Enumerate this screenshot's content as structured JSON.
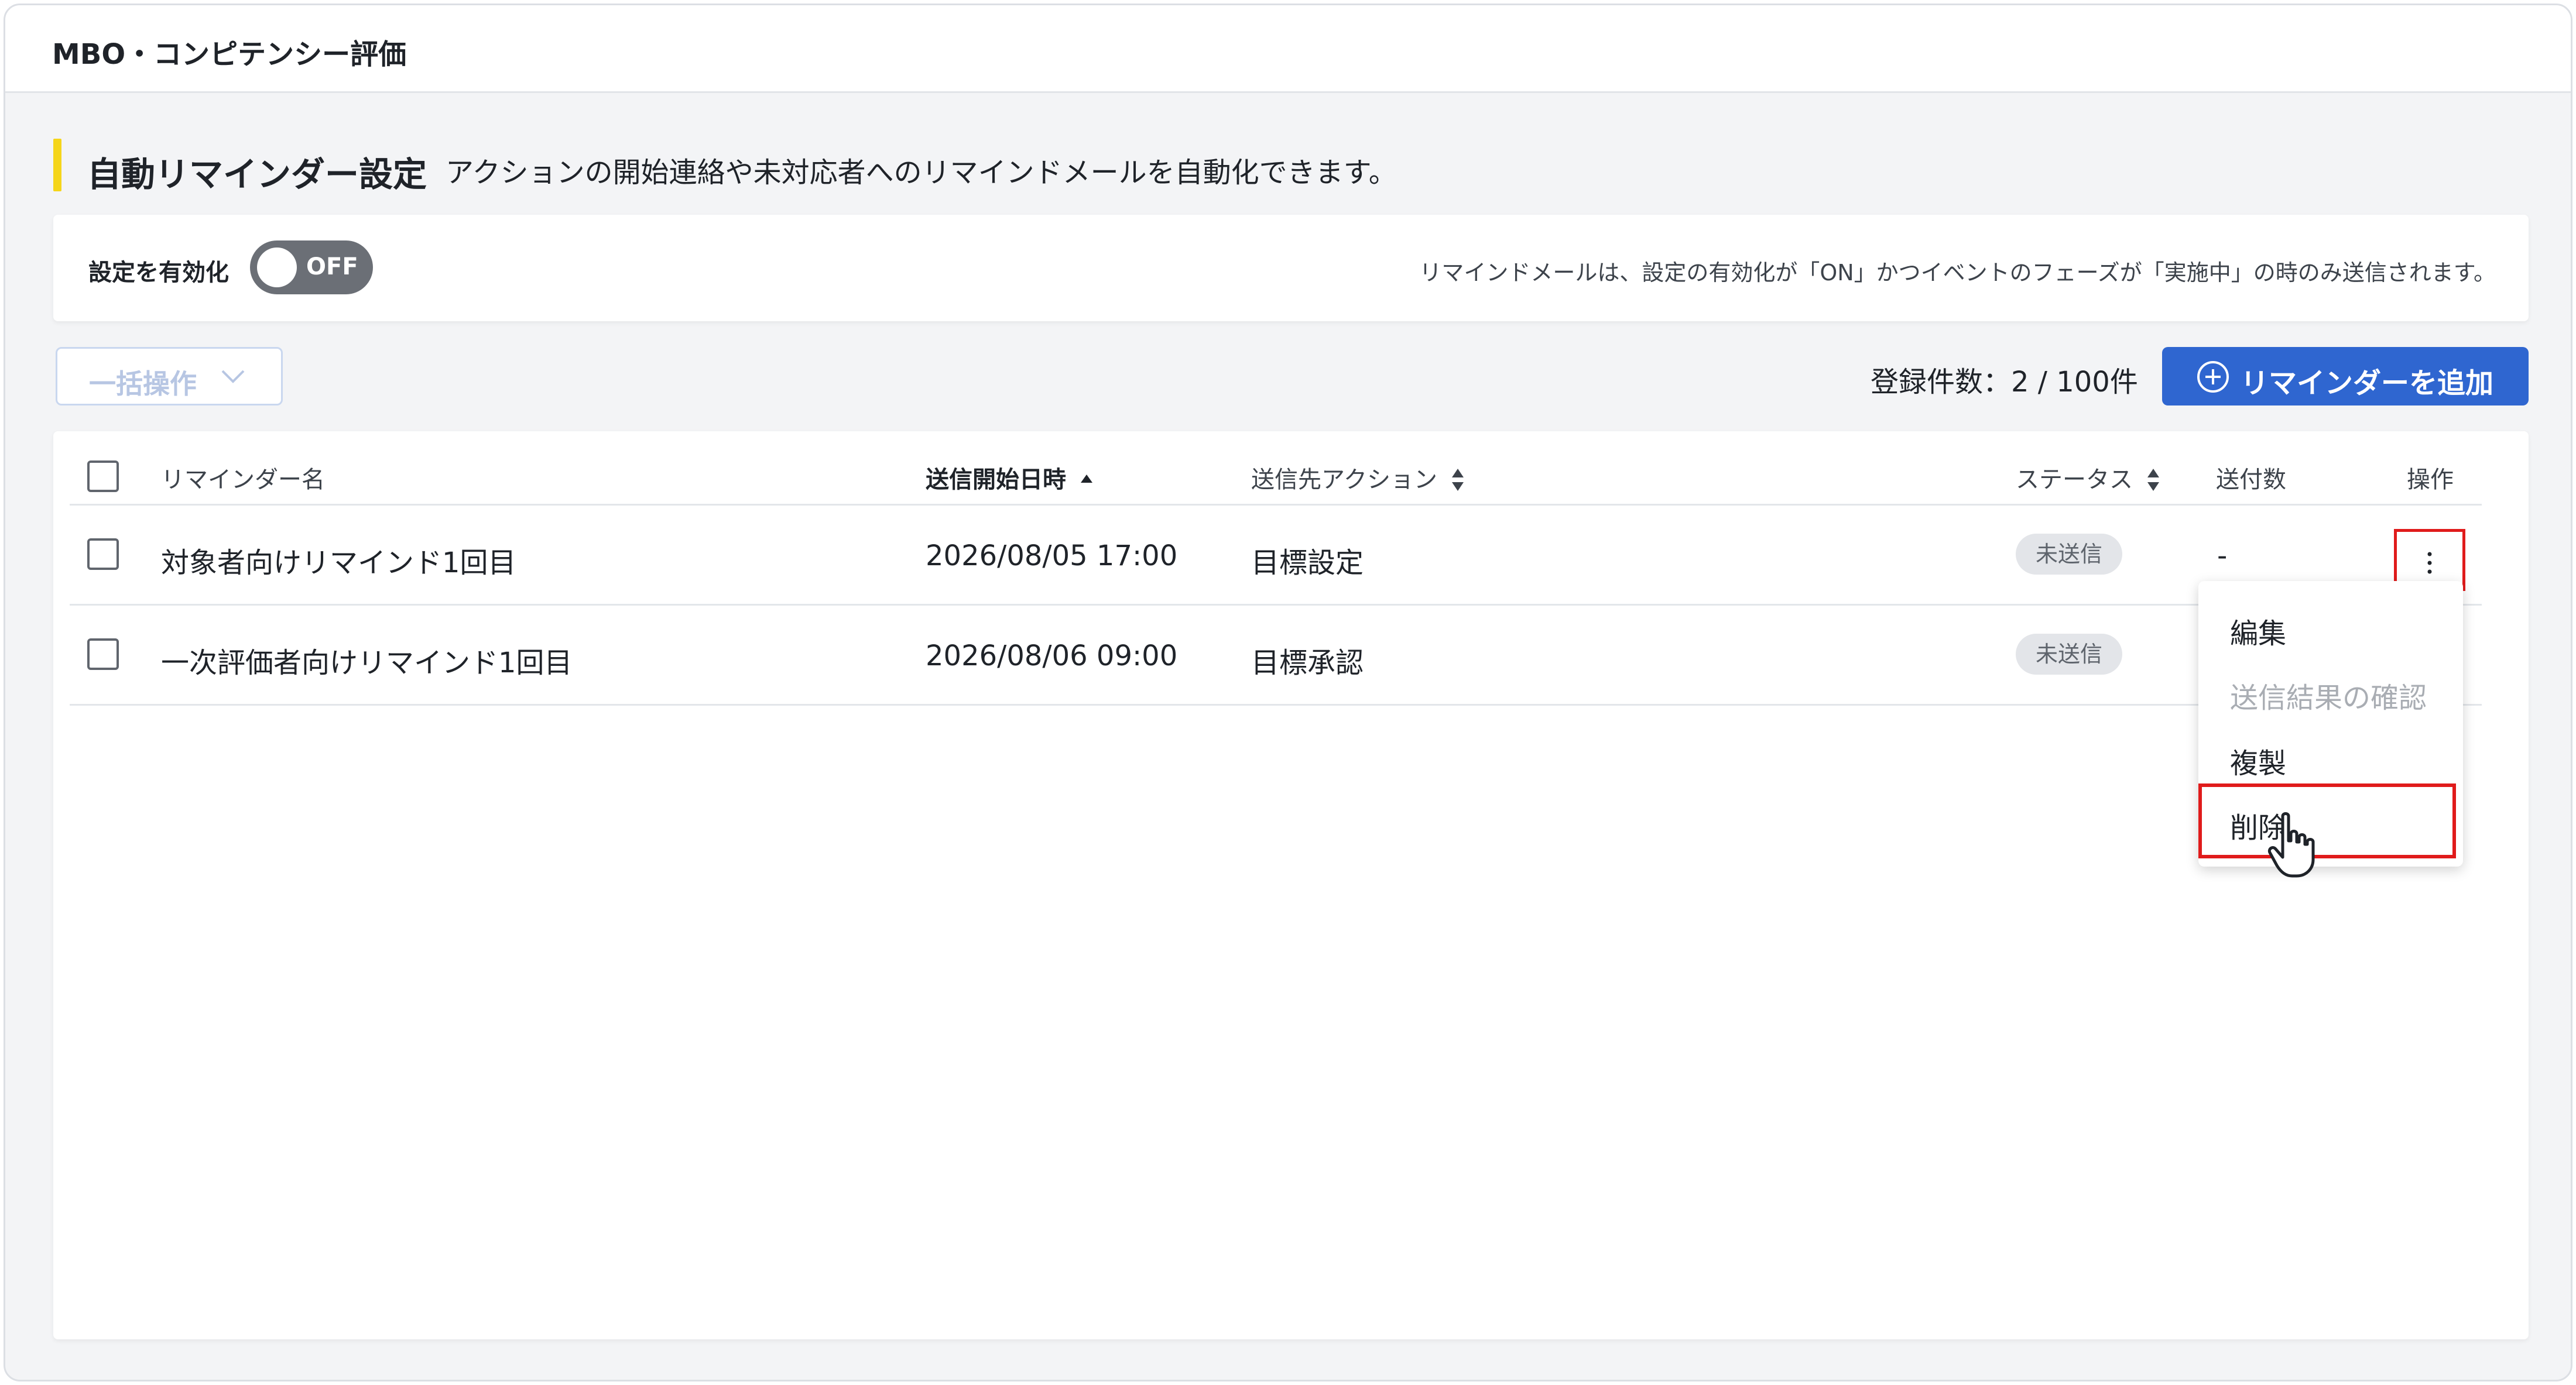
{
  "app": {
    "title": "MBO・コンピテンシー評価"
  },
  "section": {
    "title": "自動リマインダー設定",
    "description": "アクションの開始連絡や未対応者へのリマインドメールを自動化できます。"
  },
  "settings": {
    "toggle_label": "設定を有効化",
    "toggle_state": "OFF",
    "notice": "リマインドメールは、設定の有効化が「ON」かつイベントのフェーズが「実施中」の時のみ送信されます。"
  },
  "toolbar": {
    "bulk_label": "一括操作",
    "count_text": "登録件数：2 / 100件",
    "add_label": "リマインダーを追加"
  },
  "table": {
    "headers": {
      "name": "リマインダー名",
      "start": "送信開始日時",
      "action": "送信先アクション",
      "status": "ステータス",
      "sent": "送付数",
      "ops": "操作"
    },
    "rows": [
      {
        "name": "対象者向けリマインド1回目",
        "start": "2026/08/05 17:00",
        "action": "目標設定",
        "status": "未送信",
        "sent": "-"
      },
      {
        "name": "一次評価者向けリマインド1回目",
        "start": "2026/08/06 09:00",
        "action": "目標承認",
        "status": "未送信",
        "sent": ""
      }
    ]
  },
  "menu": {
    "edit": "編集",
    "results": "送信結果の確認",
    "duplicate": "複製",
    "delete": "削除"
  },
  "colors": {
    "accent_yellow": "#f5d51a",
    "primary_blue": "#2f66d0",
    "highlight_red": "#e01b1b",
    "toggle_off": "#6b6f76"
  }
}
